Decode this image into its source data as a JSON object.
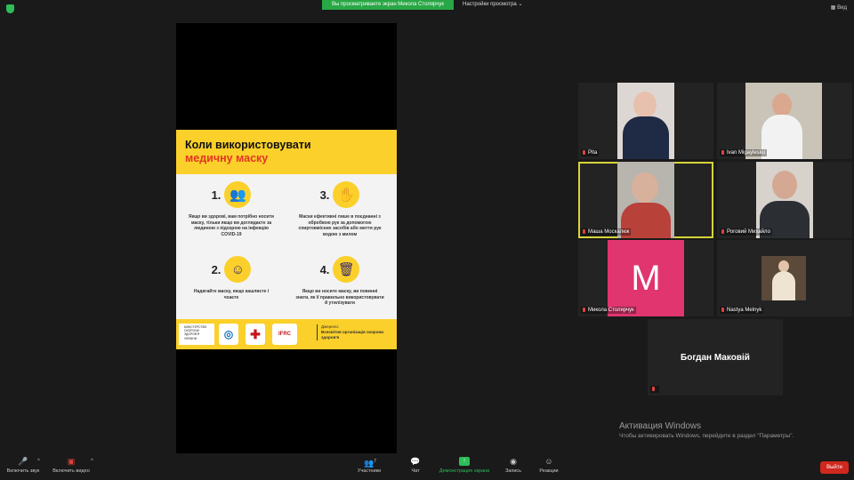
{
  "top": {
    "share_banner": "Вы просматриваете экран Микола Столярчук",
    "view_options": "Настройки просмотра",
    "fullscreen": "Вид"
  },
  "poster": {
    "title_line1": "Коли використовувати",
    "title_line2": "медичну маску",
    "tips": [
      {
        "num": "1.",
        "icon": "two-people-masks-icon",
        "text": "Якщо ви здорові, вам потрібно носити маску, тільки якщо ви доглядаєте за людиною з підозрою на інфекцію COVID-19"
      },
      {
        "num": "3.",
        "icon": "hand-washing-icon",
        "text": "Маски ефективні лише в поєднанні з обробкою рук за допомогою спиртовмісних засобів або миття рук водою з милом"
      },
      {
        "num": "2.",
        "icon": "person-mask-icon",
        "text": "Надягайте маску, якщо кашляєте і чхаєте"
      },
      {
        "num": "4.",
        "icon": "trash-bin-icon",
        "text": "Якщо ви носите маску, ви повинні знати, як її правильно використовувати й утилізувати"
      }
    ],
    "footer": {
      "ministry": "МІНІСТЕРСТВО ОХОРОНИ ЗДОРОВ'Я УКРАЇНИ",
      "ifrc": "IFRC",
      "source_label": "Джерело:",
      "source_text": "Всесвітня організація охорони здоров'я"
    }
  },
  "participants": [
    {
      "name": "Рita"
    },
    {
      "name": "Ivan Migaylesku"
    },
    {
      "name": "Маша Москалюк"
    },
    {
      "name": "Роговий Михайло"
    },
    {
      "name": "Микола Столярчук",
      "avatar_letter": "M"
    },
    {
      "name": "Nastya Melnyk"
    },
    {
      "name": "Богдан Маковій"
    }
  ],
  "watermark": {
    "title": "Активация Windows",
    "subtitle": "Чтобы активировать Windows, перейдите в раздел \"Параметры\"."
  },
  "toolbar": {
    "audio": "Включить звук",
    "video": "Включить видео",
    "participants": "Участники",
    "participants_count": "7",
    "chat": "Чат",
    "share": "Демонстрация экрана",
    "record": "Запись",
    "reactions": "Реакции",
    "leave": "Выйти"
  },
  "colors": {
    "accent_green": "#2ebd59",
    "poster_yellow": "#fbd02a",
    "leave_red": "#d0281e",
    "avatar_pink": "#e0356f",
    "active_speaker": "#d7d33a"
  }
}
